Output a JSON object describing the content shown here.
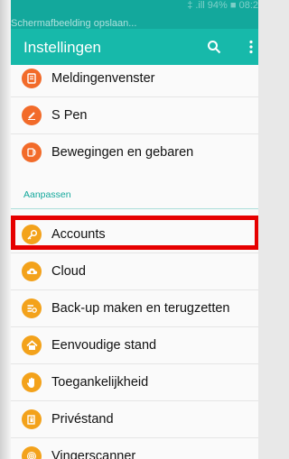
{
  "status_bar": {
    "notification_text": "Schermafbeelding opslaan...",
    "right_text": "‡ .ill 94% ■ 08:2"
  },
  "app_bar": {
    "title": "Instellingen",
    "search_icon": "search-icon",
    "more_icon": "more-vert-icon"
  },
  "items_top": [
    {
      "label": "Meldingenvenster",
      "icon": "notification-panel-icon",
      "color": "#f26b2a"
    },
    {
      "label": "S Pen",
      "icon": "s-pen-icon",
      "color": "#f26b2a"
    },
    {
      "label": "Bewegingen en gebaren",
      "icon": "motion-gesture-icon",
      "color": "#f26b2a"
    }
  ],
  "section": {
    "header": "Aanpassen"
  },
  "items_personal": [
    {
      "label": "Accounts",
      "icon": "key-icon",
      "color": "#f3a21b"
    },
    {
      "label": "Cloud",
      "icon": "cloud-icon",
      "color": "#f3a21b"
    },
    {
      "label": "Back-up maken en terugzetten",
      "icon": "backup-icon",
      "color": "#f3a21b"
    },
    {
      "label": "Eenvoudige stand",
      "icon": "easy-mode-icon",
      "color": "#f3a21b"
    },
    {
      "label": "Toegankelijkheid",
      "icon": "hand-icon",
      "color": "#f3a21b"
    },
    {
      "label": "Privéstand",
      "icon": "private-mode-icon",
      "color": "#f3a21b"
    },
    {
      "label": "Vingerscanner",
      "icon": "fingerprint-icon",
      "color": "#f3a21b"
    }
  ],
  "colors": {
    "status_bar": "#13a89c",
    "app_bar": "#17b9aa",
    "accent": "#13a89c",
    "highlight": "#e60000"
  }
}
